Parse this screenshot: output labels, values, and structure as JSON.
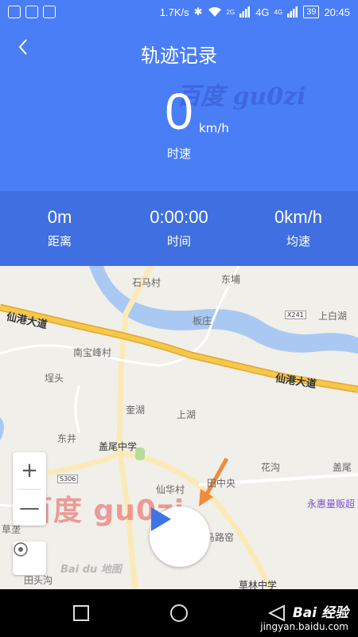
{
  "status_bar": {
    "network_speed": "1.7K/s",
    "signal_2g": "2G",
    "signal_4g_a": "4G",
    "signal_4g_b": "4G",
    "battery": "39",
    "time": "20:45"
  },
  "header": {
    "title": "轨迹记录",
    "speed_value": "0",
    "speed_unit": "km/h",
    "speed_label": "时速",
    "watermark": "百度 gu0zi"
  },
  "stats": [
    {
      "value": "0m",
      "label": "距离"
    },
    {
      "value": "0:00:00",
      "label": "时间"
    },
    {
      "value": "0km/h",
      "label": "均速"
    }
  ],
  "map": {
    "labels": {
      "shimacun": "石马村",
      "dongpu": "东埔",
      "banzhuang": "板庄",
      "shangbaihu": "上白湖",
      "xiangang_left": "仙港大道",
      "xiangang_right": "仙港大道",
      "nanbaofengcun": "南宝峰村",
      "chengtou": "埕头",
      "kuihu": "奎湖",
      "shanghu": "上湖",
      "dongjing": "东井",
      "gaiweizhongxue": "盖尾中学",
      "xianhuacun": "仙华村",
      "tianzhongyang": "田中央",
      "huagou": "花沟",
      "gaiwei": "盖尾",
      "yonghui": "永惠量贩超",
      "caozhu": "草垄",
      "tiantougou": "田头沟",
      "malubao": "马路窑",
      "caolinzhongxue": "草林中学",
      "shield_x241": "X241",
      "shield_s306": "S306"
    },
    "zoom_in": "+",
    "zoom_out": "—",
    "logo": "Bai du 地图",
    "watermark": "百度  gu0zi"
  },
  "site_watermark": {
    "brand": "Bai 经验",
    "url": "jingyan.baidu.com"
  },
  "colors": {
    "accent": "#4a7ef7",
    "stats_band": "#3f6fe0",
    "play": "#3e74e8",
    "arrow": "#f08a3c",
    "road_major": "#f5c84a",
    "river": "#a9c9f2"
  },
  "icons": {
    "back": "chevron-left-icon",
    "play": "play-icon",
    "locate": "locate-icon",
    "nav_back": "triangle-back-icon",
    "nav_home": "circle-home-icon",
    "nav_recent": "square-recent-icon"
  }
}
